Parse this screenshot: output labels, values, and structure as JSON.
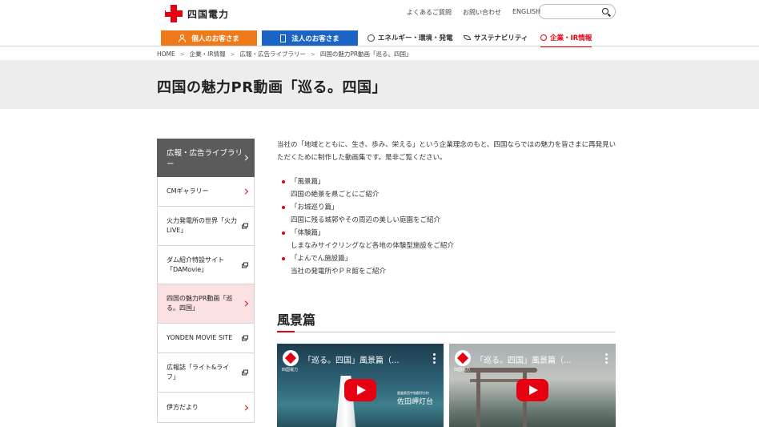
{
  "header": {
    "logo_text": "四国電力",
    "util_links": [
      "よくあるご質問",
      "お問い合わせ",
      "ENGLISH"
    ],
    "search_placeholder": ""
  },
  "nav": {
    "personal": "個人のお客さま",
    "corporate": "法人のお客さま",
    "links": [
      "エネルギー・環境・発電",
      "サステナビリティ",
      "企業・IR情報"
    ]
  },
  "breadcrumb": [
    "HOME",
    "企業・IR情報",
    "広報・広告ライブラリー",
    "四国の魅力PR動画「巡る。四国」"
  ],
  "page_title": "四国の魅力PR動画「巡る。四国」",
  "sidebar": {
    "heading": "広報・広告ライブラリー",
    "items": [
      {
        "label": "CMギャラリー",
        "type": "arrow"
      },
      {
        "label": "火力発電所の世界「火力LIVE」",
        "type": "external"
      },
      {
        "label": "ダム紹介特設サイト「DAMovie」",
        "type": "external"
      },
      {
        "label": "四国の魅力PR動画「巡る。四国」",
        "type": "arrow",
        "active": true
      },
      {
        "label": "YONDEN MOVIE SITE",
        "type": "external"
      },
      {
        "label": "広報誌「ライト&ライフ」",
        "type": "external"
      },
      {
        "label": "伊方だより",
        "type": "arrow"
      }
    ]
  },
  "main": {
    "intro": "当社の「地域とともに、生き、歩み、栄える」という企業理念のもと、四国ならではの魅力を皆さまに再発見いただくために制作した動画集です。是非ご覧ください。",
    "list": [
      {
        "title": "「風景篇」",
        "desc": "四国の絶景を県ごとにご紹介"
      },
      {
        "title": "「お城巡り篇」",
        "desc": "四国に残る城郭やその周辺の美しい庭園をご紹介"
      },
      {
        "title": "「体験篇」",
        "desc": "しまなみサイクリングなど各地の体験型施設をご紹介"
      },
      {
        "title": "「よんでん施設篇」",
        "desc": "当社の発電所やＰＲ館をご紹介"
      }
    ],
    "section_title": "風景篇",
    "videos": [
      {
        "title": "「巡る。四国」風景篇（...",
        "channel": "四国電力",
        "caption": "佐田岬灯台",
        "caption_small": "愛媛県西宇和郡伊方町"
      },
      {
        "title": "「巡る。四国」風景篇（...",
        "channel": "四国電力"
      }
    ]
  },
  "colors": {
    "brand_red": "#e60012",
    "personal_orange": "#ee7a1c",
    "corporate_blue": "#1b64c3",
    "sidebar_head": "#5b5b5b",
    "active_item": "#fbe1e1"
  }
}
